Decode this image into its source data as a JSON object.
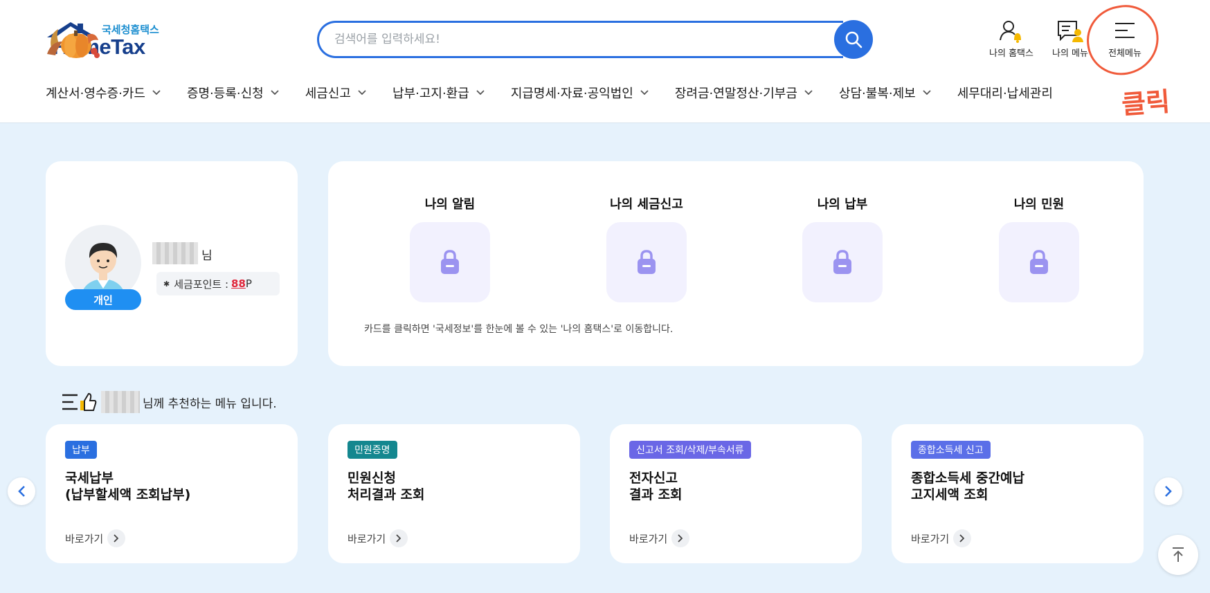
{
  "header": {
    "logo_sub": "국세청홈택스",
    "logo_main": "HomeTax",
    "search_placeholder": "검색어를 입력하세요!",
    "util": [
      {
        "label": "나의 홈택스",
        "icon": "my-hometax-icon"
      },
      {
        "label": "나의 메뉴",
        "icon": "my-menu-icon"
      },
      {
        "label": "전체메뉴",
        "icon": "hamburger-menu-icon"
      }
    ],
    "nav": [
      "계산서·영수증·카드",
      "증명·등록·신청",
      "세금신고",
      "납부·고지·환급",
      "지급명세·자료·공익법인",
      "장려금·연말정산·기부금",
      "상담·불복·제보",
      "세무대리·납세관리"
    ],
    "annotation": "클릭",
    "annotation_color": "#f05a3a"
  },
  "profile": {
    "name_suffix": "님",
    "badge": "개인",
    "points_label": "세금포인트 :",
    "points_value": "88",
    "points_unit": "P"
  },
  "summary": {
    "items": [
      "나의 알림",
      "나의 세금신고",
      "나의 납부",
      "나의 민원"
    ],
    "note": "카드를 클릭하면 '국세정보'를 한눈에 볼 수 있는 '나의 홈택스'로 이동합니다."
  },
  "recommend": {
    "title_suffix": "님께 추천하는 메뉴 입니다.",
    "goto_label": "바로가기",
    "cards": [
      {
        "tag": "납부",
        "tag_color": "#2a6fe0",
        "name": "국세납부\n(납부할세액 조회납부)"
      },
      {
        "tag": "민원증명",
        "tag_color": "#14878f",
        "name": "민원신청\n처리결과 조회"
      },
      {
        "tag": "신고서 조회/삭제/부속서류",
        "tag_color": "#6a67e6",
        "name": "전자신고\n결과 조회"
      },
      {
        "tag": "종합소득세 신고",
        "tag_color": "#5b6fe8",
        "name": "종합소득세 중간예납\n고지세액 조회"
      }
    ]
  },
  "colors": {
    "accent": "#2a6fe0",
    "background": "#e6f2fc",
    "lock": "#9b93f0"
  }
}
